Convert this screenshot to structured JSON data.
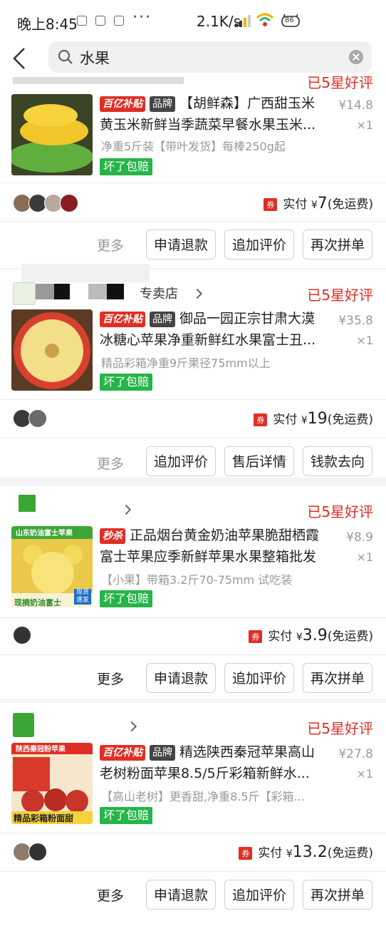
{
  "status": {
    "time": "晚上8:45",
    "speed": "2.1K/s",
    "battery": "86"
  },
  "search": {
    "query": "水果"
  },
  "orders": [
    {
      "rating": "已5星好评",
      "tags": [
        "百亿补贴",
        "品牌"
      ],
      "title": "【胡鲜森】广西甜玉米黄玉米新鲜当季蔬菜早餐水果玉米...",
      "spec": "净重5斤装【带叶发货】每棒250g起",
      "badge": "坏了包赔",
      "price": "¥14.8",
      "qty": "×1",
      "coupon": "券",
      "pay_label": "实付",
      "pay_amount": "7",
      "shipping": "(免运费)",
      "buttons": [
        "申请退款",
        "追加评价",
        "再次拼单"
      ],
      "more": "更多"
    },
    {
      "shop": "专卖店",
      "rating": "已5星好评",
      "tags": [
        "百亿补贴",
        "品牌"
      ],
      "title": "御品一园正宗甘肃大漠冰糖心苹果净重新鲜红水果富士丑...",
      "spec": "精品彩箱净重9斤果径75mm以上",
      "badge": "坏了包赔",
      "price": "¥35.8",
      "qty": "×1",
      "coupon": "券",
      "pay_label": "实付",
      "pay_amount": "19",
      "shipping": "(免运费)",
      "buttons": [
        "追加评价",
        "售后详情",
        "钱款去向"
      ],
      "more": "更多"
    },
    {
      "rating": "已5星好评",
      "tags": [
        "秒杀"
      ],
      "title": "正品烟台黄金奶油苹果脆甜栖霞富士苹果应季新鲜苹果水果整箱批发",
      "spec": "【小果】带箱3.2斤70-75mm 试吃装",
      "badge": "坏了包赔",
      "price": "¥8.9",
      "qty": "×1",
      "coupon": "券",
      "pay_label": "实付",
      "pay_amount": "3.9",
      "shipping": "(免运费)",
      "buttons": [
        "申请退款",
        "追加评价",
        "再次拼单"
      ],
      "more": "更多"
    },
    {
      "rating": "已5星好评",
      "tags": [
        "百亿补贴",
        "品牌"
      ],
      "title": "精选陕西秦冠苹果高山老树粉面苹果8.5/5斤彩箱新鲜水...",
      "spec": "【高山老树】更香甜,净重8.5斤【彩箱...",
      "badge": "坏了包赔",
      "price": "¥27.8",
      "qty": "×1",
      "coupon": "券",
      "pay_label": "实付",
      "pay_amount": "13.2",
      "shipping": "(免运费)",
      "buttons": [
        "申请退款",
        "追加评价",
        "再次拼单"
      ],
      "more": "更多"
    }
  ],
  "thumb_text": {
    "apple3_top": "山东奶油富士苹果",
    "apple3_bottom": "现摘奶油富士",
    "apple3_corner": "现货速发",
    "apple4_top": "陕西秦冠粉苹果",
    "apple4_bottom": "精品彩箱粉面甜"
  },
  "colors": {
    "accent": "#e02e24",
    "badge": "#25b548"
  }
}
